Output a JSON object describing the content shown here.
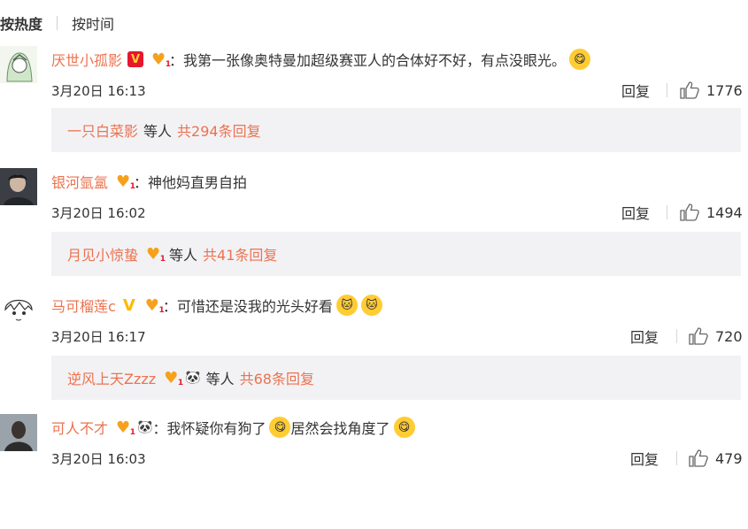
{
  "sort": {
    "hot": "按热度",
    "time": "按时间"
  },
  "comments": [
    {
      "username": "厌世小孤影",
      "badge": "V",
      "colon": "：",
      "text": "我第一张像奥特曼加超级赛亚人的合体好不好，有点没眼光。",
      "time": "3月20日 16:13",
      "reply": "回复",
      "likes": "1776",
      "sub": {
        "name": "一只白菜影",
        "mid": "等人",
        "total": "共294条回复"
      }
    },
    {
      "username": "银河氩氲",
      "colon": "：",
      "text": "神他妈直男自拍",
      "time": "3月20日 16:02",
      "reply": "回复",
      "likes": "1494",
      "sub": {
        "name": "月见小惊蛰",
        "mid": "等人",
        "total": "共41条回复"
      }
    },
    {
      "username": "马可榴莲c",
      "badge": "V",
      "colon": "：",
      "text": "可惜还是没我的光头好看",
      "time": "3月20日 16:17",
      "reply": "回复",
      "likes": "720",
      "sub": {
        "name": "逆风上天Zzzz",
        "mid": "等人",
        "total": "共68条回复"
      }
    },
    {
      "username": "可人不才",
      "colon": "：",
      "text_a": "我怀疑你有狗了",
      "text_b": "居然会找角度了",
      "time": "3月20日 16:03",
      "reply": "回复",
      "likes": "479"
    }
  ],
  "icons": {
    "like": "thumb-up-icon",
    "medal": "fan-medal-heart-icon",
    "emoji_drool": "drool-face-emoji",
    "emoji_cat": "cat-face-emoji",
    "panda": "panda-icon"
  },
  "colors": {
    "username": "#eb7350",
    "subbox": "#f2f2f5",
    "red_v": "#e6162d",
    "gold": "#ffb800"
  }
}
